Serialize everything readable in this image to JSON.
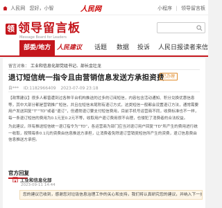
{
  "topbar": {
    "location": "人民网",
    "user_greeting": "您好，小智",
    "logo_text": "人民网",
    "logo_sub": "人民网",
    "login_label": "小程序",
    "register_label": "领导留言板"
  },
  "logo": {
    "mark": "领",
    "title": "领导留言板",
    "subtitle": "Message Board for Leaders"
  },
  "search": {
    "placeholder": ""
  },
  "nav": {
    "items": [
      {
        "label": "部委/地方"
      },
      {
        "label": "人民建议"
      },
      {
        "label": "话题"
      },
      {
        "label": "数据"
      },
      {
        "label": "投诉"
      },
      {
        "label": "人民日报读者来信"
      }
    ]
  },
  "breadcrumb": {
    "prefix": "留言对象：",
    "path": "工业和信息化部党组书记、部长金壮龙"
  },
  "message": {
    "title": "退订短信统一指令且由营销信息发送方承担资费",
    "status": "已办理",
    "author": "自***",
    "id": "ID:1182966409",
    "date": "2023-07-09 23:18",
    "paragraphs": [
      "【政策建议】很多人都曾遭到过各种平台机构推送的过多的订阅短信，内容包含活动通知、积分兑换优惠信息等，其中大部分都是营销推广短信，并且在短信末尾附有退订方式，这类短信一般都会设置退订方法，通常需要用户发送回复“T”“TD”或者“退订”，但通常退订要支付短信费用，目前手机号运营商不同，收费标准也不一样，每一条退订短信的费用为0.1元至0.2元不等，收取用户退订费用很不合理，也侵犯了消费者的合法权益。",
      "为此建议，所有推送短信统一退订指令为“TD”，各运营商为部门应当对退订用户回复“TD”所产生的费用进行统一收取，按照每条0.1元的资费由信息推送方承担，让消费者免除退订营销类短信所产生的资费，退订信息费由信息推送方承担。"
    ]
  },
  "reply": {
    "heading": "官方回复",
    "org": "工业和信息化部",
    "date": "2023-09-11 14:44",
    "text": "您的建议已收到，感谢您对垃圾信息治理工作的关心和支持，我们将认真研究您的建议，并纳入下一步工作中。"
  },
  "colors": {
    "brand": "#c4161c",
    "status": "#e08b2b",
    "reply_bg": "#fdf6e8"
  }
}
